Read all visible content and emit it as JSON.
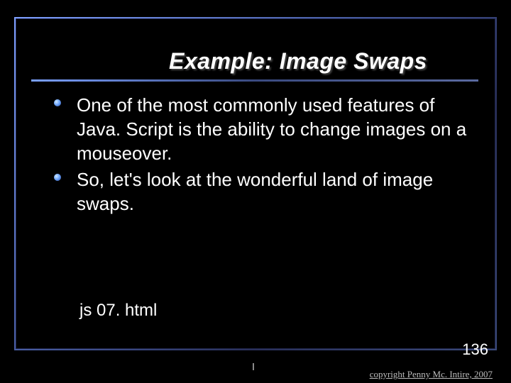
{
  "slide": {
    "title": "Example: Image Swaps",
    "bullets": [
      "One of the most commonly used features of Java. Script is the ability to change images on a mouseover.",
      "So, let's look at the wonderful land of image swaps."
    ],
    "footnote": "js 07. html",
    "page_number": "136",
    "copyright": "copyright Penny Mc. Intire, 2007"
  }
}
